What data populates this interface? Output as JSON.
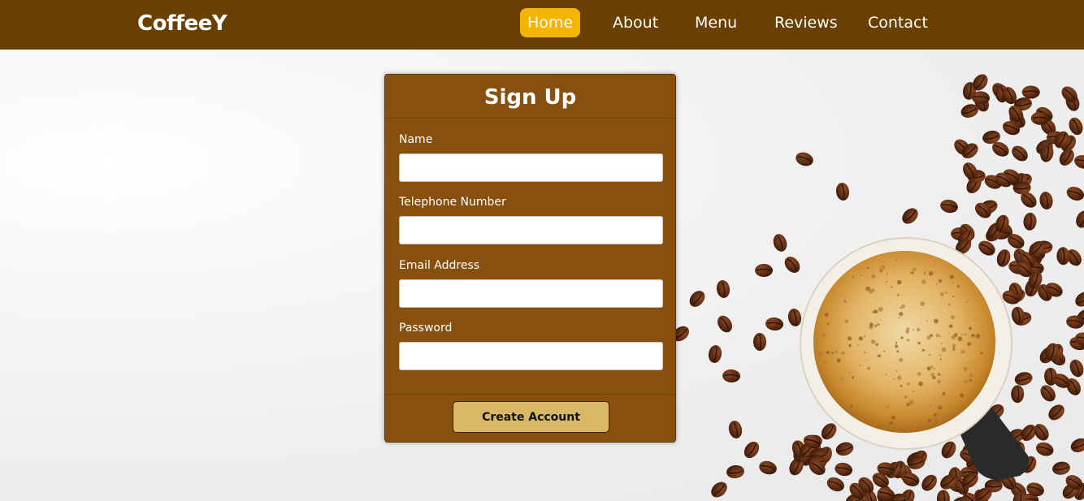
{
  "nav": {
    "brand": "CoffeeY",
    "items": [
      {
        "label": "Home",
        "active": true
      },
      {
        "label": "About"
      },
      {
        "label": "Menu"
      },
      {
        "label": "Reviews"
      },
      {
        "label": "Contact"
      }
    ]
  },
  "form": {
    "title": "Sign Up",
    "fields": [
      {
        "label": "Name",
        "value": ""
      },
      {
        "label": "Telephone Number",
        "value": ""
      },
      {
        "label": "Email Address",
        "value": ""
      },
      {
        "label": "Password",
        "value": ""
      }
    ],
    "submit_label": "Create Account"
  },
  "colors": {
    "nav_bg": "#6a3f02",
    "active_tab": "#f5b400",
    "card_bg": "#87500f",
    "button_bg": "#d8b765"
  },
  "icons": {
    "hero_image": "coffee-cup-with-beans"
  }
}
